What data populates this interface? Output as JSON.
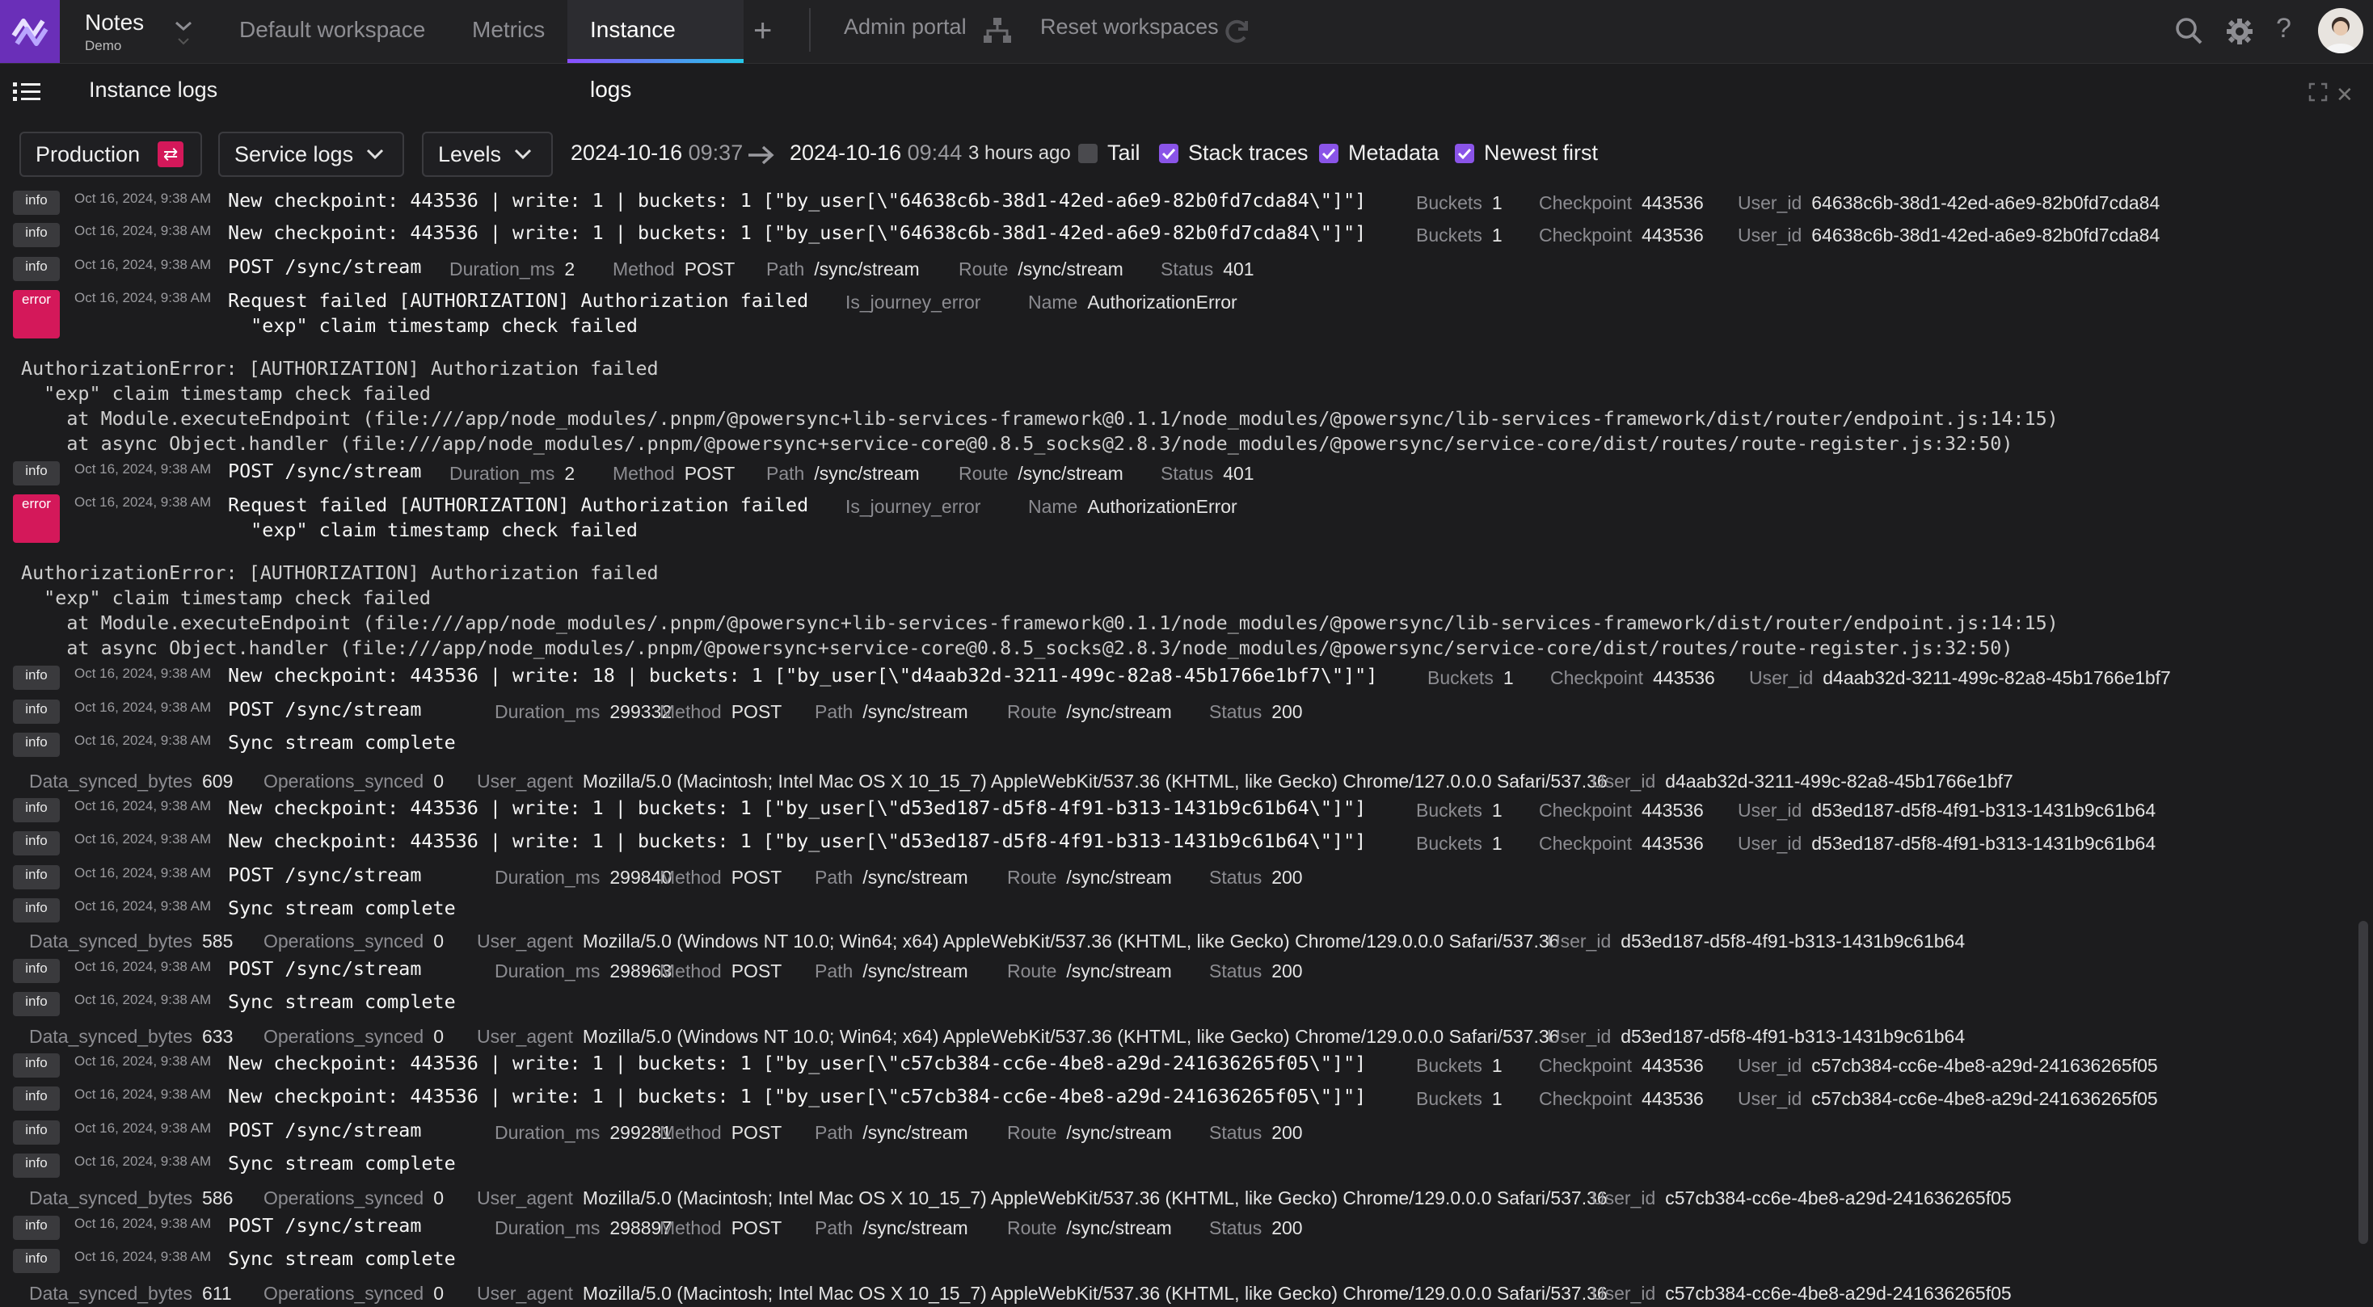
{
  "app": {
    "name": "Notes",
    "subtitle": "Demo"
  },
  "tabs": [
    {
      "label": "Default workspace",
      "active": false
    },
    {
      "label": "Metrics",
      "active": false
    },
    {
      "label": "Instance logs",
      "active": true
    }
  ],
  "top_links": {
    "admin": "Admin portal",
    "reset": "Reset workspaces"
  },
  "icons": {
    "search": "search-icon",
    "settings": "gear-icon",
    "help": "help-icon"
  },
  "panel": {
    "title": "Instance logs"
  },
  "filters": {
    "environment": "Production",
    "source": "Service logs",
    "levels": "Levels",
    "start_date": "2024-10-16",
    "start_time": "09:37",
    "end_date": "2024-10-16",
    "end_time": "09:44",
    "ago": "3 hours ago",
    "checks": [
      {
        "label": "Tail",
        "checked": false
      },
      {
        "label": "Stack traces",
        "checked": true
      },
      {
        "label": "Metadata",
        "checked": true
      },
      {
        "label": "Newest first",
        "checked": true
      }
    ]
  },
  "colors": {
    "accent": "#8a54e8",
    "error": "#d4185a",
    "logo": "#6a2fb8"
  },
  "logs": {
    "ts": "Oct 16, 2024, 9:38 AM",
    "l0": {
      "level": "info",
      "msg": "New checkpoint: 443536 | write: 1 | buckets: 1 [\"by_user[\\\"64638c6b-38d1-42ed-a6e9-82b0fd7cda84\\\"]\"]",
      "m": [
        [
          "Buckets",
          "1"
        ],
        [
          "Checkpoint",
          "443536"
        ],
        [
          "User_id",
          "64638c6b-38d1-42ed-a6e9-82b0fd7cda84"
        ]
      ]
    },
    "l1": {
      "level": "info",
      "msg": "New checkpoint: 443536 | write: 1 | buckets: 1 [\"by_user[\\\"64638c6b-38d1-42ed-a6e9-82b0fd7cda84\\\"]\"]",
      "m": [
        [
          "Buckets",
          "1"
        ],
        [
          "Checkpoint",
          "443536"
        ],
        [
          "User_id",
          "64638c6b-38d1-42ed-a6e9-82b0fd7cda84"
        ]
      ]
    },
    "l2": {
      "level": "info",
      "msg": "POST /sync/stream",
      "m": [
        [
          "Duration_ms",
          "2"
        ],
        [
          "Method",
          "POST"
        ],
        [
          "Path",
          "/sync/stream"
        ],
        [
          "Route",
          "/sync/stream"
        ],
        [
          "Status",
          "401"
        ]
      ]
    },
    "l3": {
      "level": "error",
      "msg": "Request failed [AUTHORIZATION] Authorization failed\n  \"exp\" claim timestamp check failed",
      "m": [
        [
          "Is_journey_error",
          ""
        ],
        [
          "Name",
          "AuthorizationError"
        ]
      ]
    },
    "t3": "AuthorizationError: [AUTHORIZATION] Authorization failed\n  \"exp\" claim timestamp check failed\n    at Module.executeEndpoint (file:///app/node_modules/.pnpm/@powersync+lib-services-framework@0.1.1/node_modules/@powersync/lib-services-framework/dist/router/endpoint.js:14:15)\n    at async Object.handler (file:///app/node_modules/.pnpm/@powersync+service-core@0.8.5_socks@2.8.3/node_modules/@powersync/service-core/dist/routes/route-register.js:32:50)",
    "l4": {
      "level": "info",
      "msg": "POST /sync/stream",
      "m": [
        [
          "Duration_ms",
          "2"
        ],
        [
          "Method",
          "POST"
        ],
        [
          "Path",
          "/sync/stream"
        ],
        [
          "Route",
          "/sync/stream"
        ],
        [
          "Status",
          "401"
        ]
      ]
    },
    "l5": {
      "level": "error",
      "msg": "Request failed [AUTHORIZATION] Authorization failed\n  \"exp\" claim timestamp check failed",
      "m": [
        [
          "Is_journey_error",
          ""
        ],
        [
          "Name",
          "AuthorizationError"
        ]
      ]
    },
    "t5": "AuthorizationError: [AUTHORIZATION] Authorization failed\n  \"exp\" claim timestamp check failed\n    at Module.executeEndpoint (file:///app/node_modules/.pnpm/@powersync+lib-services-framework@0.1.1/node_modules/@powersync/lib-services-framework/dist/router/endpoint.js:14:15)\n    at async Object.handler (file:///app/node_modules/.pnpm/@powersync+service-core@0.8.5_socks@2.8.3/node_modules/@powersync/service-core/dist/routes/route-register.js:32:50)",
    "l6": {
      "level": "info",
      "msg": "New checkpoint: 443536 | write: 18 | buckets: 1 [\"by_user[\\\"d4aab32d-3211-499c-82a8-45b1766e1bf7\\\"]\"]",
      "m": [
        [
          "Buckets",
          "1"
        ],
        [
          "Checkpoint",
          "443536"
        ],
        [
          "User_id",
          "d4aab32d-3211-499c-82a8-45b1766e1bf7"
        ]
      ]
    },
    "l7": {
      "level": "info",
      "msg": "POST /sync/stream",
      "m": [
        [
          "Duration_ms",
          "299332"
        ],
        [
          "Method",
          "POST"
        ],
        [
          "Path",
          "/sync/stream"
        ],
        [
          "Route",
          "/sync/stream"
        ],
        [
          "Status",
          "200"
        ]
      ]
    },
    "l8": {
      "level": "info",
      "msg": "Sync stream complete",
      "m": []
    },
    "d8": [
      [
        "Data_synced_bytes",
        "609"
      ],
      [
        "Operations_synced",
        "0"
      ],
      [
        "User_agent",
        "Mozilla/5.0 (Macintosh; Intel Mac OS X 10_15_7) AppleWebKit/537.36 (KHTML, like Gecko) Chrome/127.0.0.0 Safari/537.36"
      ],
      [
        "User_id",
        "d4aab32d-3211-499c-82a8-45b1766e1bf7"
      ]
    ],
    "l9": {
      "level": "info",
      "msg": "New checkpoint: 443536 | write: 1 | buckets: 1 [\"by_user[\\\"d53ed187-d5f8-4f91-b313-1431b9c61b64\\\"]\"]",
      "m": [
        [
          "Buckets",
          "1"
        ],
        [
          "Checkpoint",
          "443536"
        ],
        [
          "User_id",
          "d53ed187-d5f8-4f91-b313-1431b9c61b64"
        ]
      ]
    },
    "l10": {
      "level": "info",
      "msg": "New checkpoint: 443536 | write: 1 | buckets: 1 [\"by_user[\\\"d53ed187-d5f8-4f91-b313-1431b9c61b64\\\"]\"]",
      "m": [
        [
          "Buckets",
          "1"
        ],
        [
          "Checkpoint",
          "443536"
        ],
        [
          "User_id",
          "d53ed187-d5f8-4f91-b313-1431b9c61b64"
        ]
      ]
    },
    "l11": {
      "level": "info",
      "msg": "POST /sync/stream",
      "m": [
        [
          "Duration_ms",
          "299840"
        ],
        [
          "Method",
          "POST"
        ],
        [
          "Path",
          "/sync/stream"
        ],
        [
          "Route",
          "/sync/stream"
        ],
        [
          "Status",
          "200"
        ]
      ]
    },
    "l12": {
      "level": "info",
      "msg": "Sync stream complete",
      "m": []
    },
    "d12": [
      [
        "Data_synced_bytes",
        "585"
      ],
      [
        "Operations_synced",
        "0"
      ],
      [
        "User_agent",
        "Mozilla/5.0 (Windows NT 10.0; Win64; x64) AppleWebKit/537.36 (KHTML, like Gecko) Chrome/129.0.0.0 Safari/537.36"
      ],
      [
        "User_id",
        "d53ed187-d5f8-4f91-b313-1431b9c61b64"
      ]
    ],
    "l13": {
      "level": "info",
      "msg": "POST /sync/stream",
      "m": [
        [
          "Duration_ms",
          "298963"
        ],
        [
          "Method",
          "POST"
        ],
        [
          "Path",
          "/sync/stream"
        ],
        [
          "Route",
          "/sync/stream"
        ],
        [
          "Status",
          "200"
        ]
      ]
    },
    "l14": {
      "level": "info",
      "msg": "Sync stream complete",
      "m": []
    },
    "d14": [
      [
        "Data_synced_bytes",
        "633"
      ],
      [
        "Operations_synced",
        "0"
      ],
      [
        "User_agent",
        "Mozilla/5.0 (Windows NT 10.0; Win64; x64) AppleWebKit/537.36 (KHTML, like Gecko) Chrome/129.0.0.0 Safari/537.36"
      ],
      [
        "User_id",
        "d53ed187-d5f8-4f91-b313-1431b9c61b64"
      ]
    ],
    "l15": {
      "level": "info",
      "msg": "New checkpoint: 443536 | write: 1 | buckets: 1 [\"by_user[\\\"c57cb384-cc6e-4be8-a29d-241636265f05\\\"]\"]",
      "m": [
        [
          "Buckets",
          "1"
        ],
        [
          "Checkpoint",
          "443536"
        ],
        [
          "User_id",
          "c57cb384-cc6e-4be8-a29d-241636265f05"
        ]
      ]
    },
    "l16": {
      "level": "info",
      "msg": "New checkpoint: 443536 | write: 1 | buckets: 1 [\"by_user[\\\"c57cb384-cc6e-4be8-a29d-241636265f05\\\"]\"]",
      "m": [
        [
          "Buckets",
          "1"
        ],
        [
          "Checkpoint",
          "443536"
        ],
        [
          "User_id",
          "c57cb384-cc6e-4be8-a29d-241636265f05"
        ]
      ]
    },
    "l17": {
      "level": "info",
      "msg": "POST /sync/stream",
      "m": [
        [
          "Duration_ms",
          "299281"
        ],
        [
          "Method",
          "POST"
        ],
        [
          "Path",
          "/sync/stream"
        ],
        [
          "Route",
          "/sync/stream"
        ],
        [
          "Status",
          "200"
        ]
      ]
    },
    "l18": {
      "level": "info",
      "msg": "Sync stream complete",
      "m": []
    },
    "d18": [
      [
        "Data_synced_bytes",
        "586"
      ],
      [
        "Operations_synced",
        "0"
      ],
      [
        "User_agent",
        "Mozilla/5.0 (Macintosh; Intel Mac OS X 10_15_7) AppleWebKit/537.36 (KHTML, like Gecko) Chrome/129.0.0.0 Safari/537.36"
      ],
      [
        "User_id",
        "c57cb384-cc6e-4be8-a29d-241636265f05"
      ]
    ],
    "l19": {
      "level": "info",
      "msg": "POST /sync/stream",
      "m": [
        [
          "Duration_ms",
          "298897"
        ],
        [
          "Method",
          "POST"
        ],
        [
          "Path",
          "/sync/stream"
        ],
        [
          "Route",
          "/sync/stream"
        ],
        [
          "Status",
          "200"
        ]
      ]
    },
    "l20": {
      "level": "info",
      "msg": "Sync stream complete",
      "m": []
    },
    "d20": [
      [
        "Data_synced_bytes",
        "611"
      ],
      [
        "Operations_synced",
        "0"
      ],
      [
        "User_agent",
        "Mozilla/5.0 (Macintosh; Intel Mac OS X 10_15_7) AppleWebKit/537.36 (KHTML, like Gecko) Chrome/129.0.0.0 Safari/537.36"
      ],
      [
        "User_id",
        "c57cb384-cc6e-4be8-a29d-241636265f05"
      ]
    ]
  }
}
